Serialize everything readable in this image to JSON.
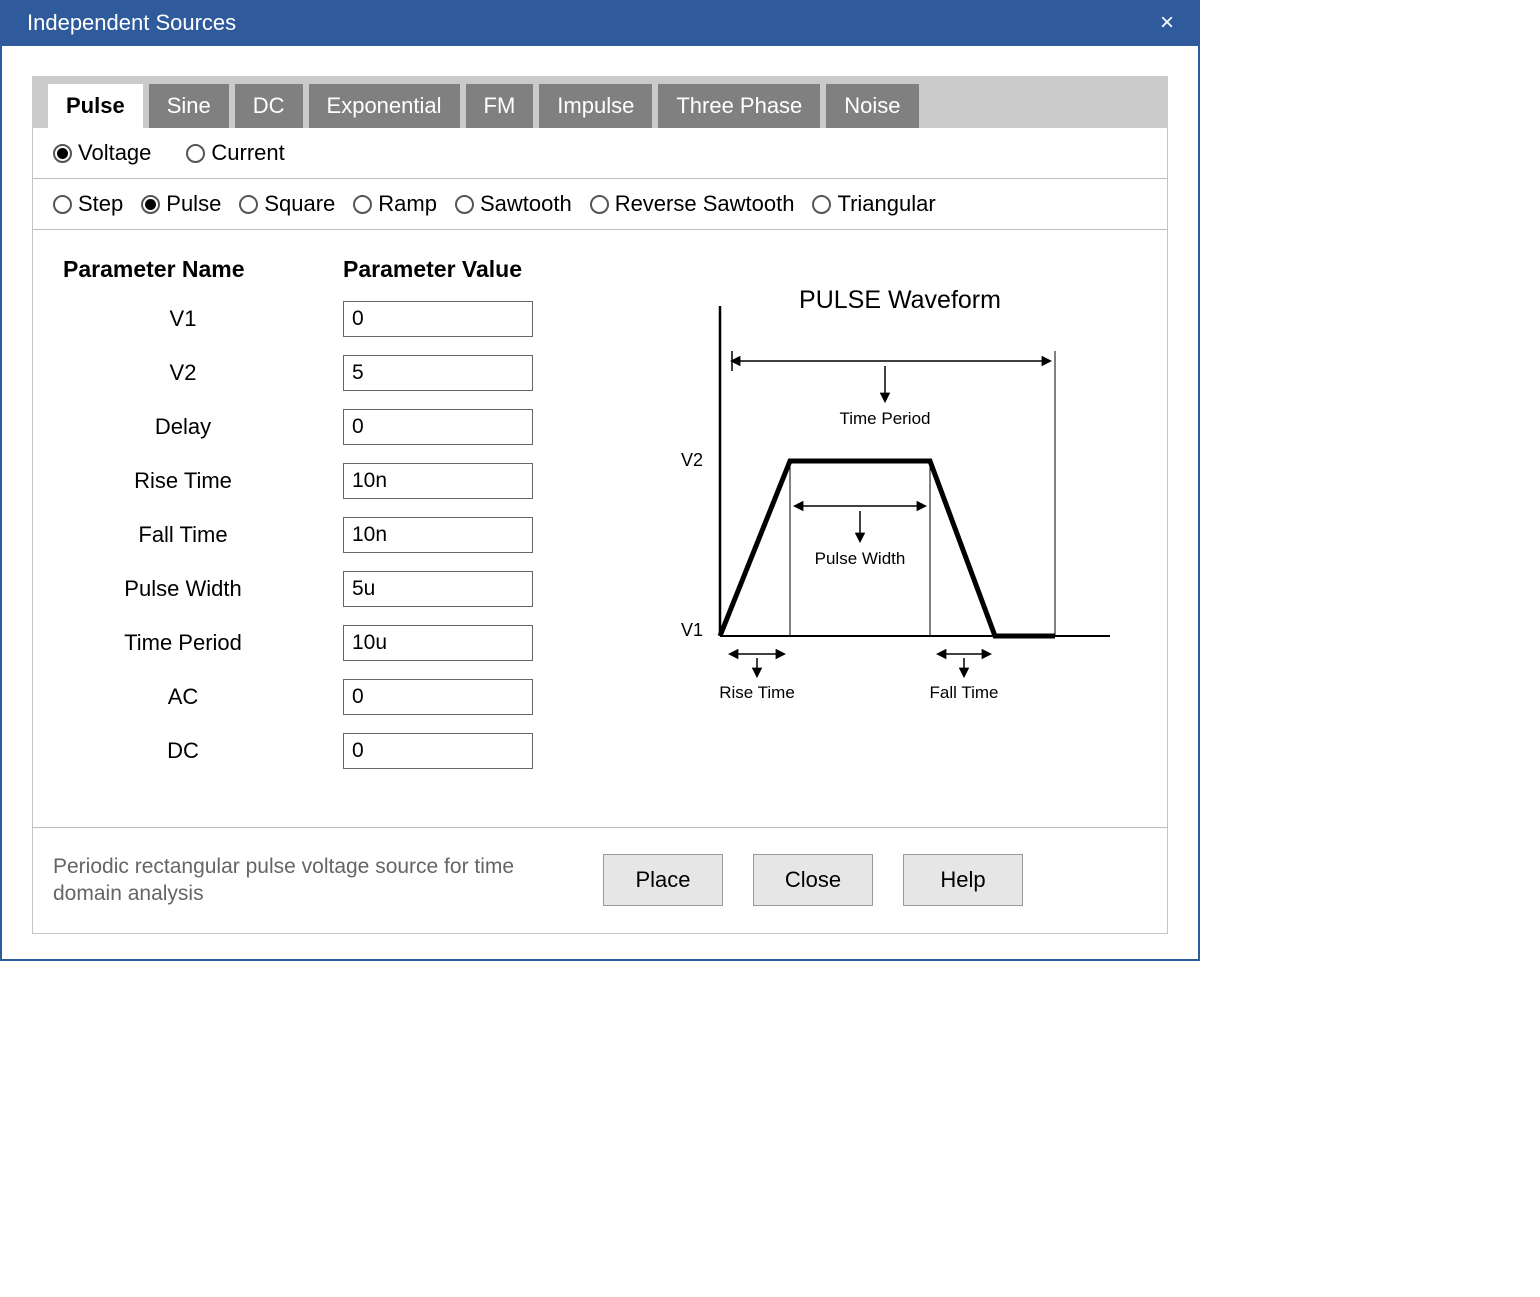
{
  "window": {
    "title": "Independent Sources"
  },
  "tabs": [
    {
      "label": "Pulse",
      "active": true
    },
    {
      "label": "Sine"
    },
    {
      "label": "DC"
    },
    {
      "label": "Exponential"
    },
    {
      "label": "FM"
    },
    {
      "label": "Impulse"
    },
    {
      "label": "Three Phase"
    },
    {
      "label": "Noise"
    }
  ],
  "source_type": {
    "voltage": "Voltage",
    "current": "Current",
    "selected": "voltage"
  },
  "waveforms": [
    {
      "id": "step",
      "label": "Step"
    },
    {
      "id": "pulse",
      "label": "Pulse"
    },
    {
      "id": "square",
      "label": "Square"
    },
    {
      "id": "ramp",
      "label": "Ramp"
    },
    {
      "id": "sawtooth",
      "label": "Sawtooth"
    },
    {
      "id": "revsaw",
      "label": "Reverse Sawtooth"
    },
    {
      "id": "tri",
      "label": "Triangular"
    }
  ],
  "waveform_selected": "pulse",
  "headers": {
    "name": "Parameter Name",
    "value": "Parameter Value"
  },
  "params": [
    {
      "name": "V1",
      "value": "0"
    },
    {
      "name": "V2",
      "value": "5"
    },
    {
      "name": "Delay",
      "value": "0"
    },
    {
      "name": "Rise Time",
      "value": "10n"
    },
    {
      "name": "Fall Time",
      "value": "10n"
    },
    {
      "name": "Pulse Width",
      "value": "5u"
    },
    {
      "name": "Time Period",
      "value": "10u"
    },
    {
      "name": "AC",
      "value": "0"
    },
    {
      "name": "DC",
      "value": "0"
    }
  ],
  "diagram": {
    "title": "PULSE Waveform",
    "label_v2": "V2",
    "label_v1": "V1",
    "label_period": "Time Period",
    "label_pw": "Pulse Width",
    "label_rise": "Rise Time",
    "label_fall": "Fall Time"
  },
  "footer": {
    "description": "Periodic rectangular pulse voltage source for time domain analysis",
    "place": "Place",
    "close": "Close",
    "help": "Help"
  }
}
